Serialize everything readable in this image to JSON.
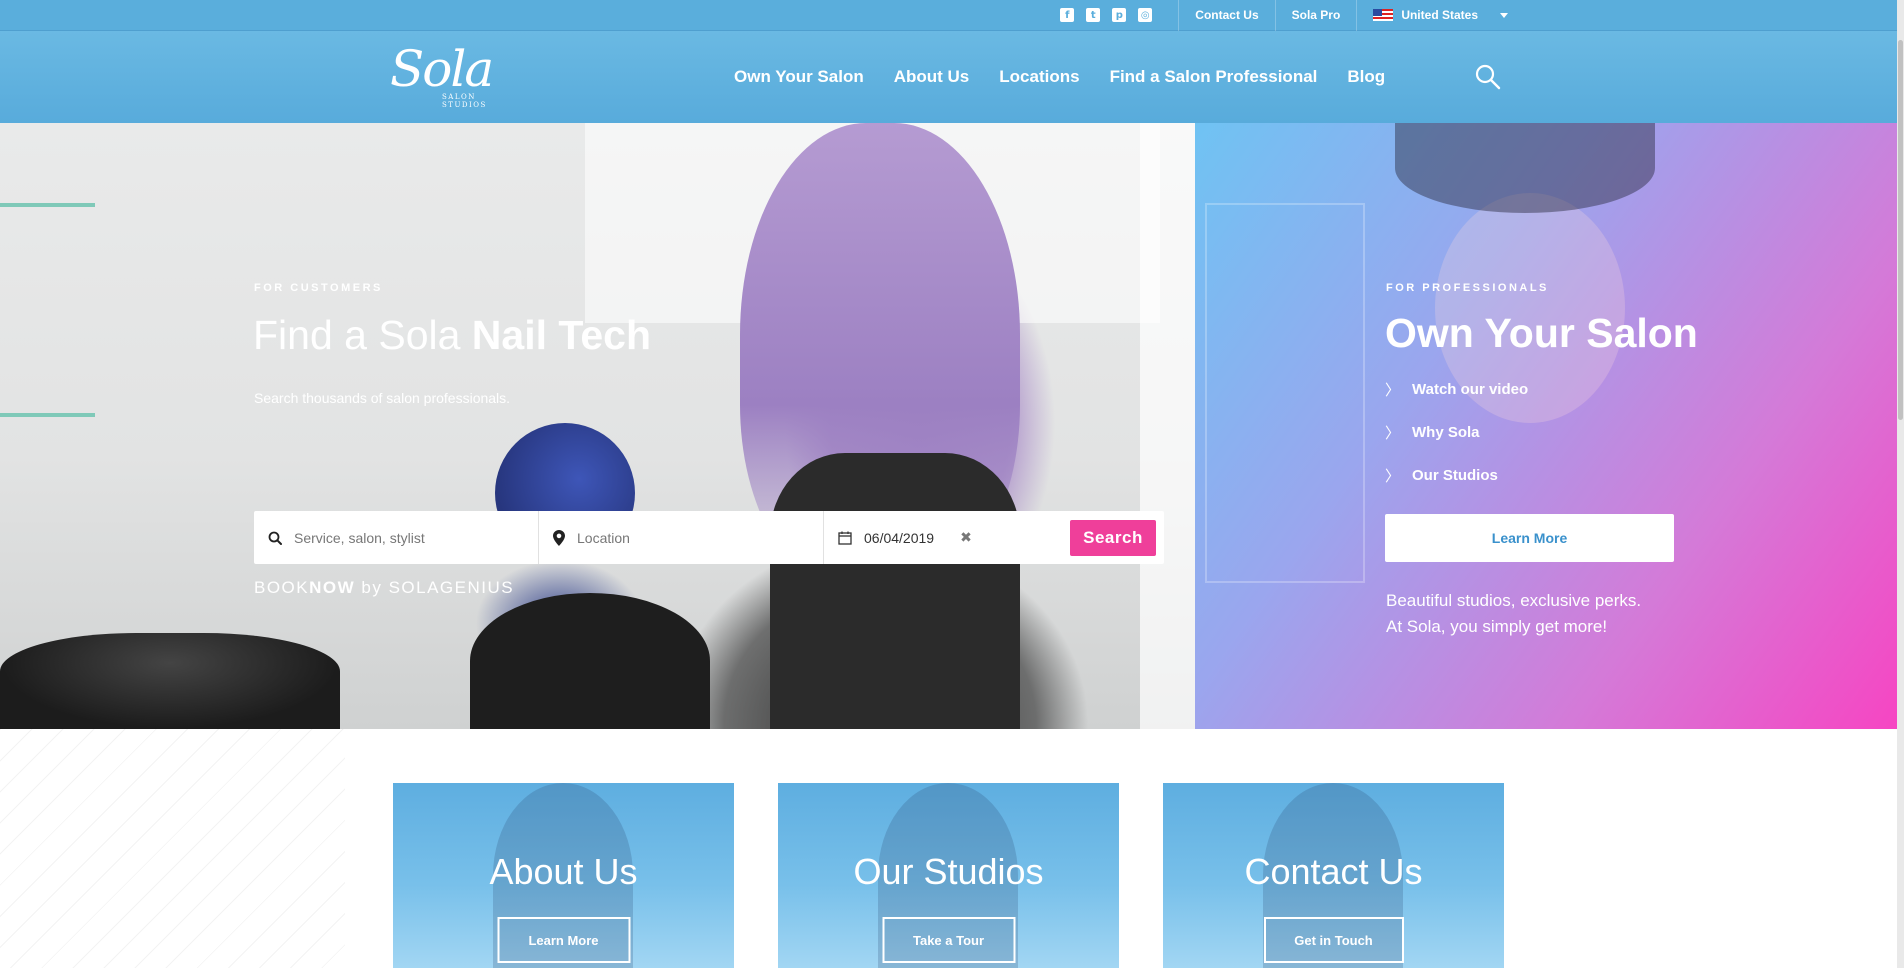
{
  "topbar": {
    "social": [
      {
        "icon": "facebook-icon",
        "glyph": "f"
      },
      {
        "icon": "twitter-icon",
        "glyph": "t"
      },
      {
        "icon": "pinterest-icon",
        "glyph": "p"
      },
      {
        "icon": "instagram-icon",
        "glyph": "◎"
      }
    ],
    "contact_us": "Contact Us",
    "sola_pro": "Sola Pro",
    "country": "United States"
  },
  "header": {
    "logo_script": "Sola",
    "logo_sub": "SALON STUDIOS",
    "nav": [
      "Own Your Salon",
      "About Us",
      "Locations",
      "Find a Salon Professional",
      "Blog"
    ]
  },
  "customers": {
    "eyebrow": "FOR CUSTOMERS",
    "title_prefix": "Find a Sola ",
    "title_bold": "Nail Tech",
    "subtitle": "Search thousands of salon professionals.",
    "search_placeholder": "Service, salon, stylist",
    "location_placeholder": "Location",
    "date_value": "06/04/2019",
    "clear_glyph": "✖",
    "search_button": "Search",
    "booknow_prefix": "BOOK",
    "booknow_bold": "NOW",
    "booknow_suffix": " by SOLAGENIUS"
  },
  "professionals": {
    "eyebrow": "FOR PROFESSIONALS",
    "title": "Own Your Salon",
    "links": [
      "Watch our video",
      "Why Sola",
      "Our Studios"
    ],
    "learn_more": "Learn More",
    "description_line1": "Beautiful studios, exclusive perks.",
    "description_line2": "At Sola, you simply get more!"
  },
  "cards": [
    {
      "title": "About Us",
      "button": "Learn More"
    },
    {
      "title": "Our Studios",
      "button": "Take a Tour"
    },
    {
      "title": "Contact Us",
      "button": "Get in Touch"
    }
  ],
  "colors": {
    "header_blue": "#5aaedc",
    "pink_accent": "#ef3f9a",
    "link_blue": "#3a91cc"
  }
}
